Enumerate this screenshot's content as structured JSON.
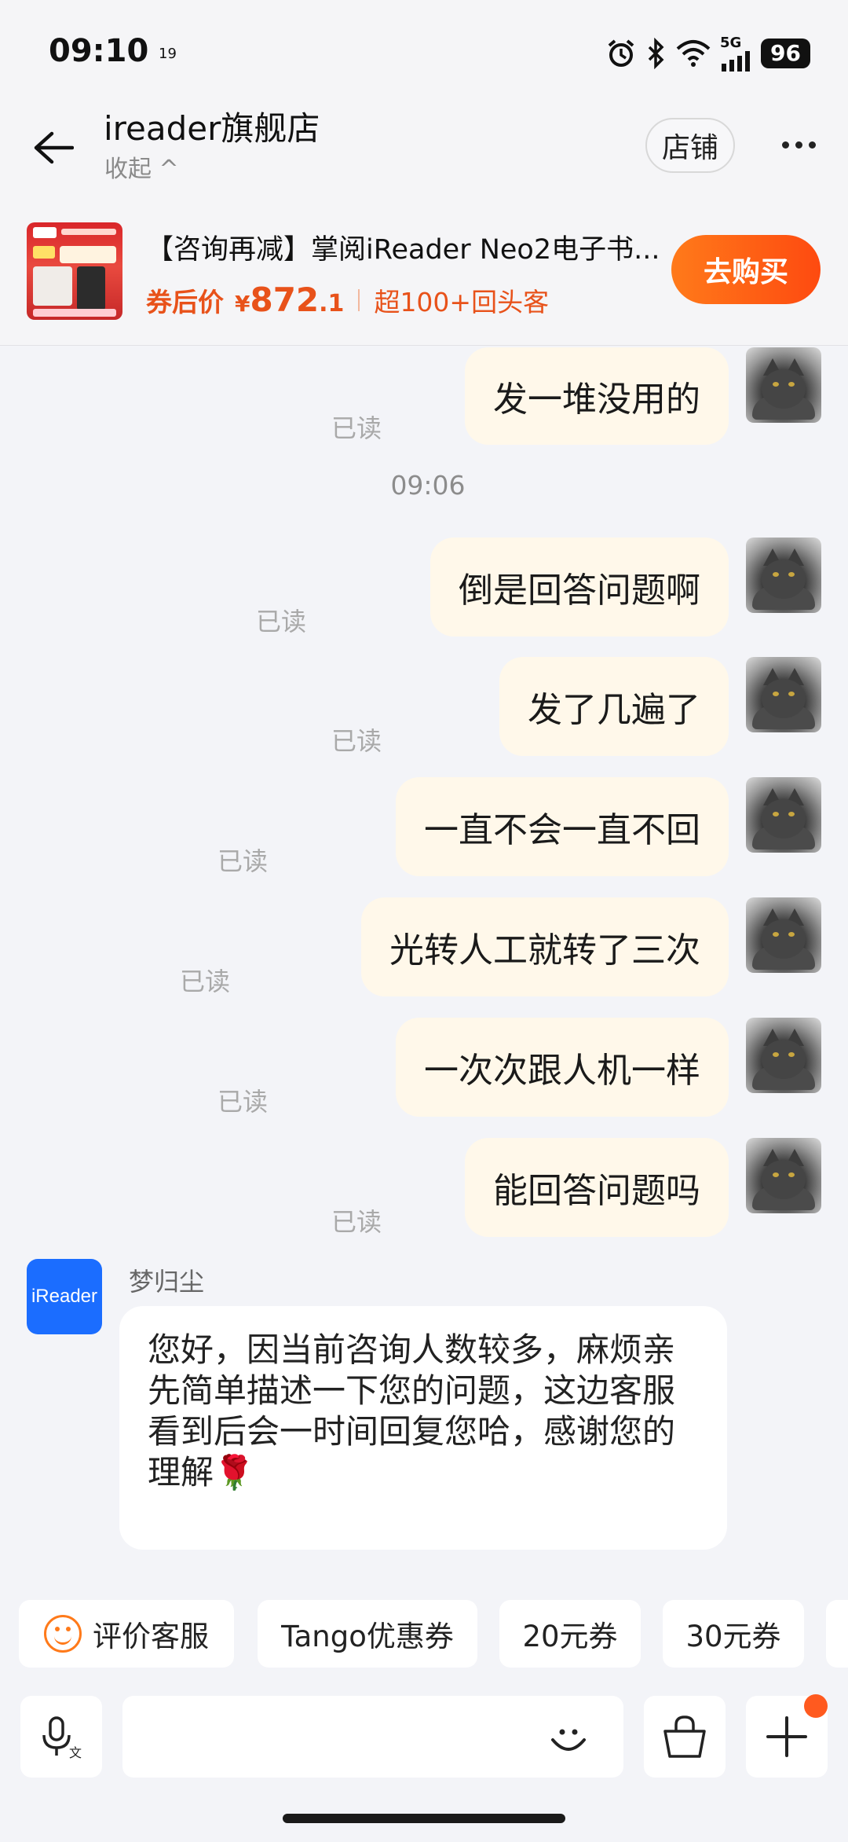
{
  "status_bar": {
    "time": "09:10",
    "notification_badge": "19",
    "network": "5G",
    "battery": "96"
  },
  "header": {
    "shop_name": "ireader旗舰店",
    "collapse_label": "收起 ^",
    "store_button": "店铺"
  },
  "product": {
    "title": "【咨询再减】掌阅iReader Neo2电子书...",
    "price_label": "券后价",
    "currency": "¥",
    "price_int": "872",
    "price_dec": ".1",
    "returning_customers": "超100+回头客",
    "buy_button": "去购买"
  },
  "messages": {
    "outgoing_top": {
      "text": "发一堆没用的",
      "status": "已读"
    },
    "timestamp": "09:06",
    "outgoing": [
      {
        "text": "倒是回答问题啊",
        "status": "已读"
      },
      {
        "text": "发了几遍了",
        "status": "已读"
      },
      {
        "text": "一直不会一直不回",
        "status": "已读"
      },
      {
        "text": "光转人工就转了三次",
        "status": "已读"
      },
      {
        "text": "一次次跟人机一样",
        "status": "已读"
      },
      {
        "text": "能回答问题吗",
        "status": "已读"
      }
    ],
    "incoming": {
      "avatar_text": "iReader",
      "sender": "梦归尘",
      "text": "您好，因当前咨询人数较多，麻烦亲先简单描述一下您的问题，这边客服看到后会一时间回复您哈，感谢您的理解",
      "emoji": "🌹"
    }
  },
  "quick_chips": [
    {
      "label": "评价客服"
    },
    {
      "label": "Tango优惠券"
    },
    {
      "label": "20元券"
    },
    {
      "label": "30元券"
    }
  ],
  "input_bar": {
    "placeholder": ""
  },
  "colors": {
    "accent": "#fe5a14",
    "outgoing_bubble": "#fff8ea",
    "background": "#f3f4f8",
    "brand_blue": "#1b6dff"
  }
}
